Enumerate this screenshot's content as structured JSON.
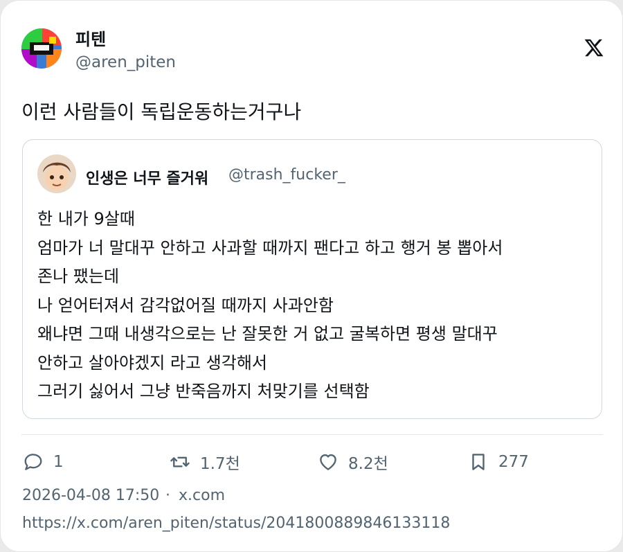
{
  "tweet": {
    "display_name": "피텐",
    "handle": "@aren_piten",
    "text": "이런 사람들이 독립운동하는거구나"
  },
  "quote": {
    "display_name": "인생은 너무 즐거워",
    "handle": "@trash_fucker_",
    "lines": [
      "한 내가 9살때",
      "엄마가 너 말대꾸 안하고 사과할 때까지 팬다고 하고 행거 봉 뽑아서",
      "존나 팼는데",
      "나 얻어터져서 감각없어질 때까지 사과안함",
      "왜냐면 그때 내생각으로는 난 잘못한 거 없고 굴복하면 평생 말대꾸",
      "안하고 살아야겠지 라고 생각해서",
      "그러기 싫어서 그냥 반죽음까지 처맞기를 선택함"
    ]
  },
  "actions": {
    "reply_count": "1",
    "retweet_count": "1.7천",
    "like_count": "8.2천",
    "bookmark_count": "277"
  },
  "meta": {
    "timestamp": "2026-04-08 17:50",
    "separator": "·",
    "source": "x.com",
    "url": "https://x.com/aren_piten/status/2041800889846133118"
  },
  "icons": {
    "brand": "x-logo-icon",
    "reply": "reply-icon",
    "retweet": "retweet-icon",
    "like": "heart-icon",
    "bookmark": "bookmark-icon"
  }
}
